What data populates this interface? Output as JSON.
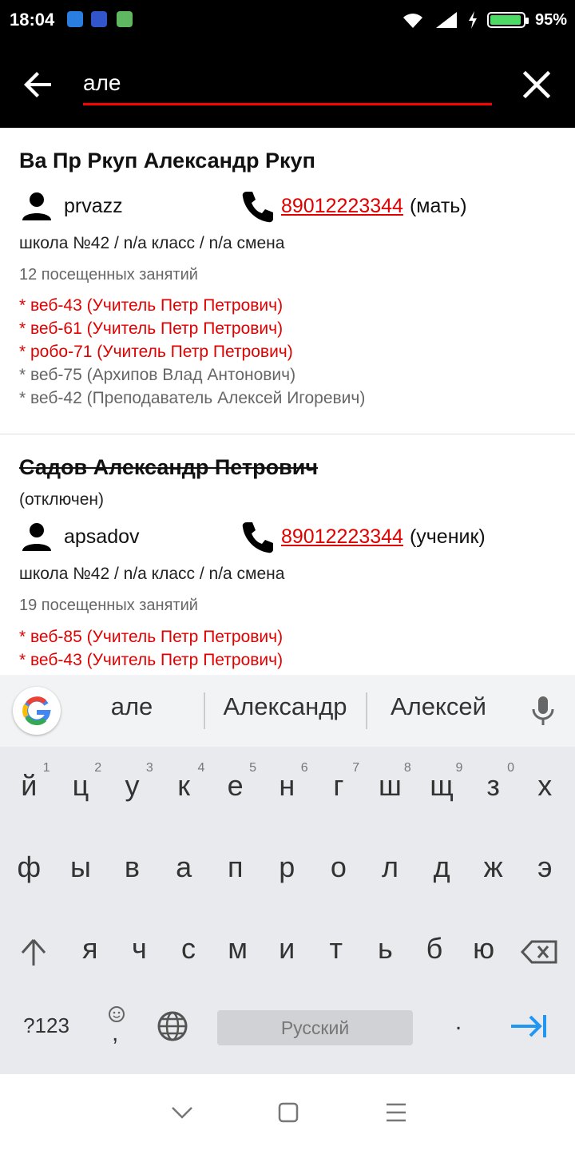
{
  "status_bar": {
    "time": "18:04",
    "battery": "95%",
    "battery_level": 0.95
  },
  "search": {
    "query": "але"
  },
  "results": [
    {
      "name": "Ва Пр Ркуп Александр Ркуп",
      "disabled": false,
      "disabled_label": "",
      "login": "prvazz",
      "phone": "89012223344",
      "phone_owner": "(мать)",
      "school": "школа №42 / n/a класс / n/a смена",
      "visits": "12 посещенных занятий",
      "groups": [
        {
          "text": "* веб-43 (Учитель Петр Петрович)",
          "active": true
        },
        {
          "text": "* веб-61 (Учитель Петр Петрович)",
          "active": true
        },
        {
          "text": "* робо-71 (Учитель Петр Петрович)",
          "active": true
        },
        {
          "text": "* веб-75 (Архипов Влад Антонович)",
          "active": false
        },
        {
          "text": "* веб-42 (Преподаватель Алексей Игоревич)",
          "active": false
        }
      ]
    },
    {
      "name": "Садов Александр Петрович",
      "disabled": true,
      "disabled_label": "(отключен)",
      "login": "apsadov",
      "phone": "89012223344",
      "phone_owner": "(ученик)",
      "school": "школа №42 / n/a класс / n/a смена",
      "visits": "19 посещенных занятий",
      "groups": [
        {
          "text": "* веб-85 (Учитель Петр Петрович)",
          "active": true
        },
        {
          "text": "* веб-43 (Учитель Петр Петрович)",
          "active": true
        }
      ]
    }
  ],
  "keyboard": {
    "suggestions": [
      "але",
      "Александр",
      "Алексей"
    ],
    "row1": [
      "й",
      "ц",
      "у",
      "к",
      "е",
      "н",
      "г",
      "ш",
      "щ",
      "з",
      "х"
    ],
    "row1_hints": [
      "1",
      "2",
      "3",
      "4",
      "5",
      "6",
      "7",
      "8",
      "9",
      "0",
      ""
    ],
    "row2": [
      "ф",
      "ы",
      "в",
      "а",
      "п",
      "р",
      "о",
      "л",
      "д",
      "ж",
      "э"
    ],
    "row3": [
      "я",
      "ч",
      "с",
      "м",
      "и",
      "т",
      "ь",
      "б",
      "ю"
    ],
    "symbols_label": "?123",
    "comma": ",",
    "period": ".",
    "space_label": "Русский"
  },
  "colors": {
    "accent": "#e00000",
    "appbar": "#000000",
    "submit": "#2196f3"
  }
}
